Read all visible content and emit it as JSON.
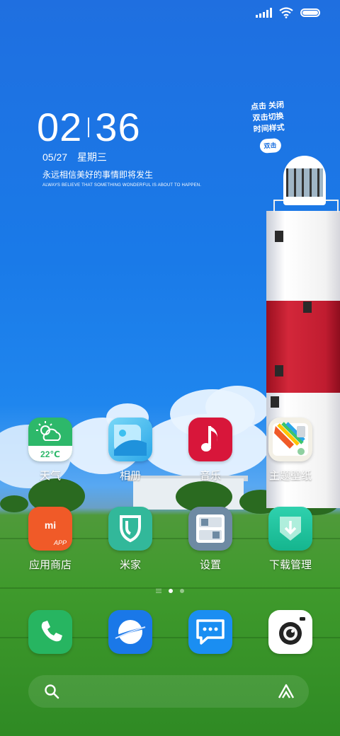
{
  "status_bar": {
    "signal_icon": "signal-bars-icon",
    "wifi_icon": "wifi-icon",
    "battery_icon": "battery-icon"
  },
  "clock_widget": {
    "hours": "02",
    "minutes": "36",
    "date": "05/27",
    "weekday": "星期三",
    "quote_cn": "永远相信美好的事情即将发生",
    "quote_en": "ALWAYS BELIEVE THAT SOMETHING WONDERFUL IS ABOUT TO HAPPEN."
  },
  "hint_widget": {
    "line1": "点击 关闭",
    "line2": "双击切换",
    "line3": "时间样式",
    "bubble": "双击"
  },
  "apps": [
    {
      "label": "天气",
      "icon": "weather-icon",
      "temp": "22℃"
    },
    {
      "label": "相册",
      "icon": "gallery-icon"
    },
    {
      "label": "音乐",
      "icon": "music-icon"
    },
    {
      "label": "主题壁纸",
      "icon": "themes-icon"
    },
    {
      "label": "应用商店",
      "icon": "app-store-icon",
      "logo": "mi",
      "badge": "APP"
    },
    {
      "label": "米家",
      "icon": "mijia-icon"
    },
    {
      "label": "设置",
      "icon": "settings-icon"
    },
    {
      "label": "下载管理",
      "icon": "downloads-icon"
    }
  ],
  "page_indicator": {
    "pages": 2,
    "current": 1
  },
  "dock": [
    {
      "name": "phone",
      "icon": "phone-icon"
    },
    {
      "name": "browser",
      "icon": "browser-icon"
    },
    {
      "name": "messages",
      "icon": "messages-icon"
    },
    {
      "name": "camera",
      "icon": "camera-icon"
    }
  ],
  "search_bar": {
    "search_icon": "search-icon",
    "assistant_icon": "assistant-icon"
  },
  "colors": {
    "weather": "#2db86a",
    "music": "#d8163a",
    "app_store": "#f05a28",
    "mijia": "#32b89a",
    "settings": "#6e8aa3",
    "downloads": "#1fbf9b",
    "phone": "#27b561",
    "browser": "#1a78e8",
    "messages": "#1a8ef2",
    "camera": "#ffffff"
  }
}
